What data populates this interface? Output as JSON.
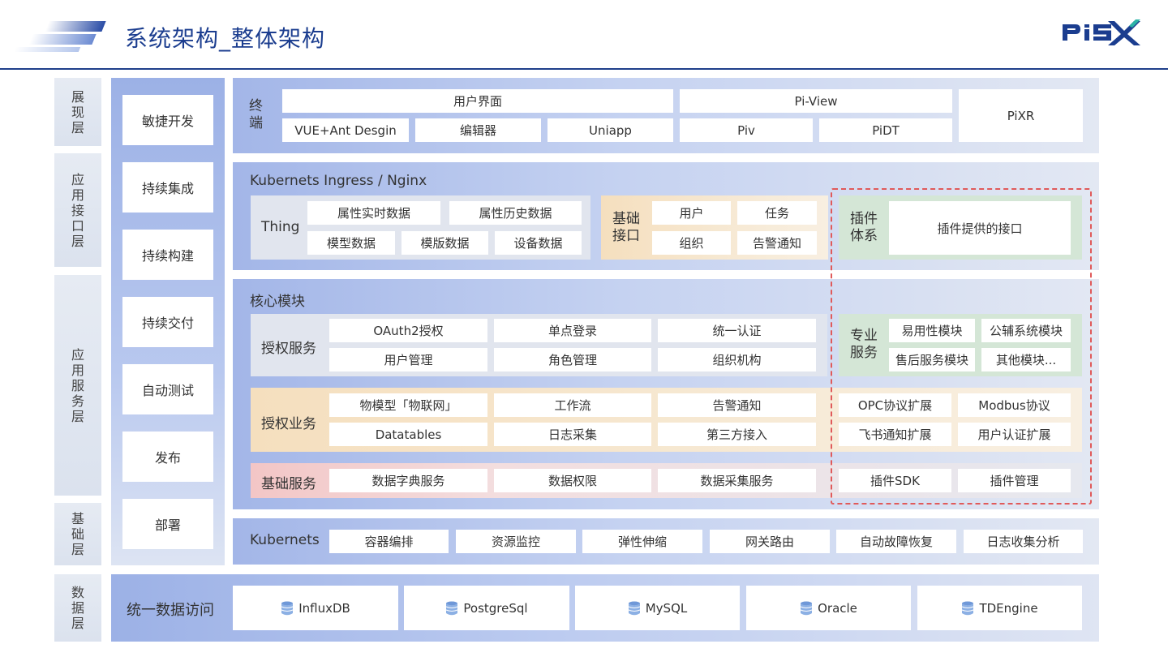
{
  "header": {
    "title": "系统架构_整体架构",
    "logo": "PISX"
  },
  "layers": {
    "display": "展\n现\n层",
    "app_interface": "应\n用\n接\n口\n层",
    "app_service": "应\n用\n服\n务\n层",
    "base": "基\n础\n层",
    "data": "数\n据\n层"
  },
  "devops": [
    "敏捷开发",
    "持续集成",
    "持续构建",
    "持续交付",
    "自动测试",
    "发布",
    "部署"
  ],
  "terminal": {
    "label": "终\n端",
    "user_ui": "用户界面",
    "pi_view": "Pi-View",
    "pixr": "PiXR",
    "items": [
      "VUE+Ant Desgin",
      "编辑器",
      "Uniapp",
      "Piv",
      "PiDT"
    ]
  },
  "ingress": {
    "title": "Kubernets Ingress / Nginx",
    "thing": {
      "label": "Thing",
      "items": [
        "属性实时数据",
        "属性历史数据",
        "模型数据",
        "模版数据",
        "设备数据"
      ]
    },
    "base_api": {
      "label": "基础\n接口",
      "items": [
        "用户",
        "任务",
        "组织",
        "告警通知"
      ]
    },
    "plugin": {
      "label": "插件\n体系",
      "item": "插件提供的接口"
    }
  },
  "core": {
    "title": "核心模块",
    "auth_service": {
      "label": "授权服务",
      "items": [
        "OAuth2授权",
        "单点登录",
        "统一认证",
        "用户管理",
        "角色管理",
        "组织机构"
      ]
    },
    "pro_service": {
      "label": "专业\n服务",
      "items": [
        "易用性模块",
        "公辅系统模块",
        "售后服务模块",
        "其他模块..."
      ]
    },
    "auth_business": {
      "label": "授权业务",
      "items": [
        "物模型「物联网」",
        "工作流",
        "告警通知",
        "Datatables",
        "日志采集",
        "第三方接入"
      ]
    },
    "ext": [
      "OPC协议扩展",
      "Modbus协议",
      "飞书通知扩展",
      "用户认证扩展"
    ],
    "base_service": {
      "label": "基础服务",
      "items": [
        "数据字典服务",
        "数据权限",
        "数据采集服务"
      ]
    },
    "plugin_items": [
      "插件SDK",
      "插件管理"
    ]
  },
  "kubernets": {
    "label": "Kubernets",
    "items": [
      "容器编排",
      "资源监控",
      "弹性伸缩",
      "网关路由",
      "自动故障恢复",
      "日志收集分析"
    ]
  },
  "data_access": {
    "label": "统一数据访问",
    "items": [
      "InfluxDB",
      "PostgreSql",
      "MySQL",
      "Oracle",
      "TDEngine"
    ]
  },
  "colors": {
    "brand": "#1b3d8f",
    "dash": "#e05a5a"
  }
}
